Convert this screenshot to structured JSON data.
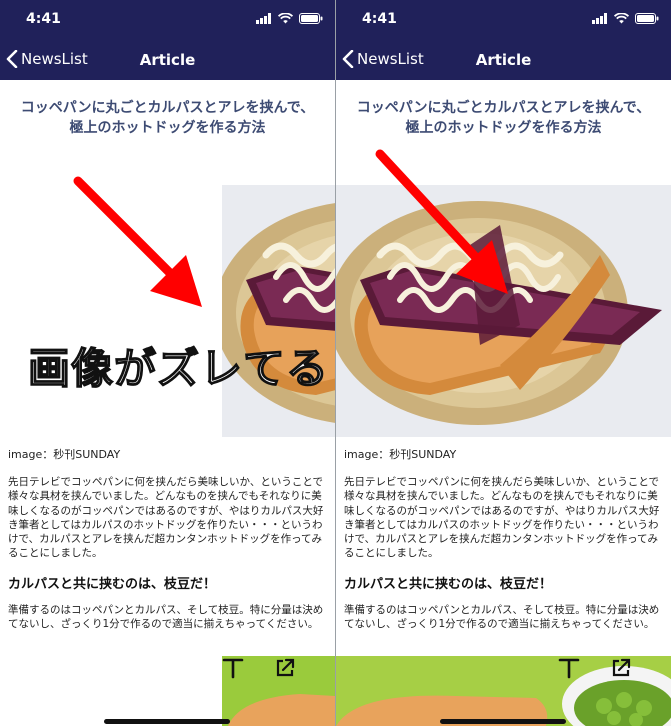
{
  "status": {
    "time": "4:41"
  },
  "nav": {
    "back_label": "NewsList",
    "title": "Article"
  },
  "article": {
    "headline": "コッペパンに丸ごとカルパスとアレを挟んで、極上のホットドッグを作る方法",
    "credit": "image：秒刊SUNDAY",
    "paragraph1": "先日テレビでコッペパンに何を挟んだら美味しいか、ということで様々な具材を挟んでいました。どんなものを挟んでもそれなりに美味しくなるのがコッペパンではあるのですが、やはりカルパス大好き筆者としてはカルパスのホットドッグを作りたい・・・というわけで、カルパスとアレを挟んだ超カンタンホットドッグを作ってみることにしました。",
    "subheading": "カルパスと共に挟むのは、枝豆だ！",
    "paragraph2": "準備するのはコッペパンとカルパス、そして枝豆。特に分量は決めてないし、ざっくり1分で作るので適当に揃えちゃってください。"
  },
  "annotation": {
    "caption": "画像がズレてる",
    "arrow_color": "#ff0000"
  },
  "toolbar": {
    "text_icon": "text-format-icon",
    "share_icon": "share-external-icon"
  },
  "colors": {
    "nav_bg": "#20215a",
    "headline": "#3d4b73",
    "accent": "#ff0000"
  }
}
